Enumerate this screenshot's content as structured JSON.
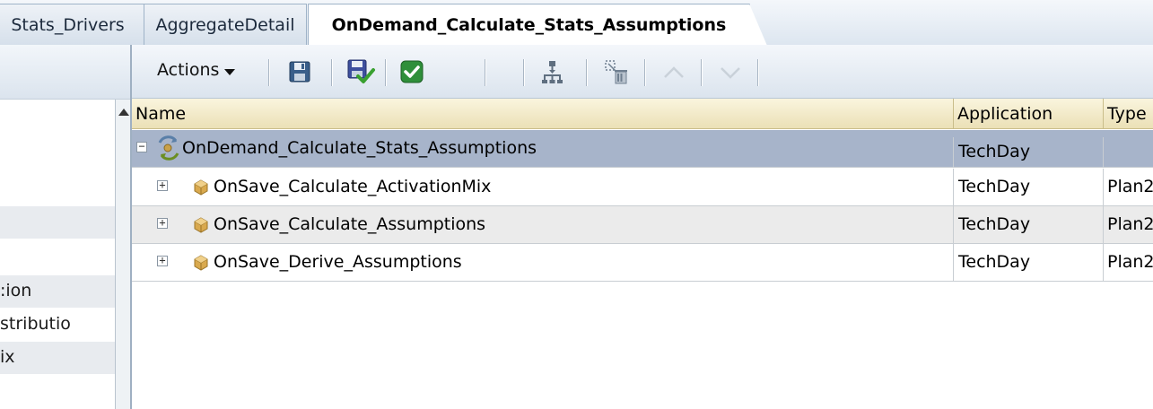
{
  "tabs": [
    {
      "label": "Stats_Drivers",
      "active": false
    },
    {
      "label": "AggregateDetail",
      "active": false
    },
    {
      "label": "OnDemand_Calculate_Stats_Assumptions",
      "active": true
    }
  ],
  "left_panel": {
    "items": [
      {
        "label": "",
        "alt": false
      },
      {
        "label": "",
        "alt": false
      },
      {
        "label": "",
        "alt": false
      },
      {
        "label": "",
        "alt": true
      },
      {
        "label": "",
        "alt": false
      },
      {
        "label": ":ion",
        "alt": true
      },
      {
        "label": "stributio",
        "alt": false
      },
      {
        "label": "ix",
        "alt": true
      },
      {
        "label": "",
        "alt": false
      }
    ]
  },
  "toolbar": {
    "actions_label": "Actions",
    "buttons": [
      {
        "icon": "save-icon",
        "enabled": true
      },
      {
        "icon": "save-as-icon",
        "enabled": true
      },
      {
        "icon": "validate-icon",
        "enabled": true
      },
      {
        "icon": "hierarchy-icon",
        "enabled": true
      },
      {
        "icon": "remove-icon",
        "enabled": true
      },
      {
        "icon": "move-up-icon",
        "enabled": false
      },
      {
        "icon": "move-down-icon",
        "enabled": false
      }
    ]
  },
  "grid": {
    "columns": [
      "Name",
      "Application",
      "Type"
    ],
    "rows": [
      {
        "name": "OnDemand_Calculate_Stats_Assumptions",
        "application": "TechDay",
        "type": "",
        "expander": "−",
        "icon": "ruleset-icon",
        "level": 0,
        "selected": true
      },
      {
        "name": "OnSave_Calculate_ActivationMix",
        "application": "TechDay",
        "type": "Plan2",
        "expander": "+",
        "icon": "rule-icon",
        "level": 1,
        "selected": false
      },
      {
        "name": "OnSave_Calculate_Assumptions",
        "application": "TechDay",
        "type": "Plan2",
        "expander": "+",
        "icon": "rule-icon",
        "level": 1,
        "selected": false
      },
      {
        "name": "OnSave_Derive_Assumptions",
        "application": "TechDay",
        "type": "Plan2",
        "expander": "+",
        "icon": "rule-icon",
        "level": 1,
        "selected": false
      }
    ]
  },
  "colors": {
    "selected_row": "#a7b4ca",
    "header_bg": "#ebe0b6",
    "alt_row": "#ebebeb"
  }
}
